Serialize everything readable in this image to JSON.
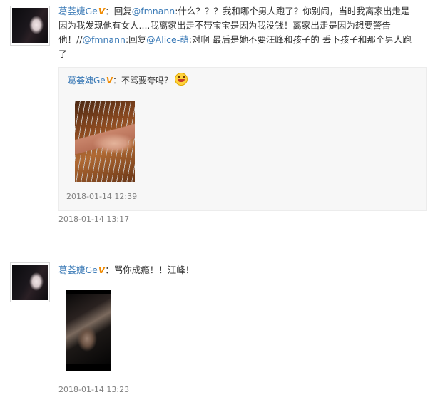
{
  "posts": [
    {
      "user": "葛荟婕Ge",
      "badge": "V",
      "text_parts": [
        {
          "t": "text",
          "v": "：回复"
        },
        {
          "t": "mention",
          "v": "@fmnann"
        },
        {
          "t": "text",
          "v": ":什么？？？我和哪个男人跑了？你别闹，当时我离家出走是因为我发现他有女人....我离家出走不带宝宝是因为我没钱！离家出走是因为想要警告他！//"
        },
        {
          "t": "mention",
          "v": "@fmnann"
        },
        {
          "t": "text",
          "v": ":回复"
        },
        {
          "t": "mention",
          "v": "@Alice-萌"
        },
        {
          "t": "text",
          "v": ":对啊 最后是她不要汪峰和孩子的 丢下孩子和那个男人跑了"
        }
      ],
      "repost": {
        "user": "葛荟婕Ge",
        "badge": "V",
        "text": "：不骂要夸吗？",
        "emoji": "laughing-tears-emoji",
        "time": "2018-01-14 12:39"
      },
      "time": "2018-01-14 13:17"
    },
    {
      "user": "葛荟婕Ge",
      "badge": "V",
      "text": "：骂你成瘾！！汪峰！",
      "time": "2018-01-14 13:23"
    }
  ]
}
